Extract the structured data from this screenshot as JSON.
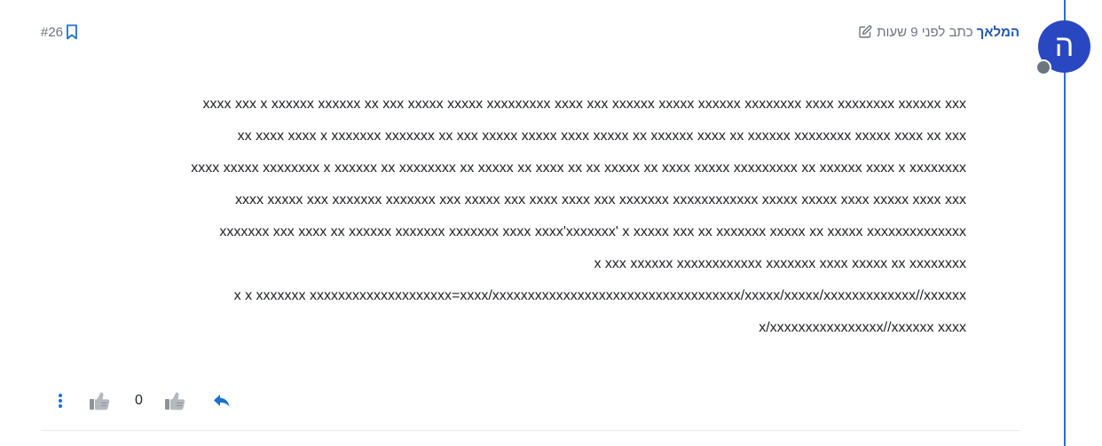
{
  "post": {
    "author_avatar_letter": "ה",
    "author_name": "המלאך",
    "meta_text": "כתב לפני 9 שעות",
    "index": "#26",
    "body_lines": [
      "xxxx xxx x xxxxxx xxxxxx xx xxx xxxxx xxxxx xxxxxxxxx xxxx xxx xxxxxx xxxxx xxxxxx xxxxxxxx xxxx xxxxxxxx xxxxxx xxx",
      "xx xxxx xxxx x xxxxxxx xxxxxxx xx xxx xxxxx xxxxx xxxx xxxxx xx xxxxxx xxxx xx xxxxxx xxxxxxxx xxxxx xxxx xx xxx",
      "xxxx xxxxx xxxxxxxx x xxxxxx xx xxxxxxxx xx xxxxx xx xxxx xx xx xxxxx xx xxxx xxxxx xxxxxxxxx xx xxxxxx xxxx x xxxxxxxx",
      "xxxx xxxxx xxx xxxxxxx xxxxxxx xxx xxxxx xxx xxxx xxxx xxx xxxxxxx xxxxxxxxxxxx xxxxx xxxxx xxxx xxxxx xxxx xxx",
      "xxxxxxx xxx xxxx xx xxxxxx xxxxxxx xxxxxxx xxxx xxxx'xxxxxxx' x xxxxx xxx xx xxxxxxx xxxxx xx xxxxx xxxxxxxxxxxxxx",
      "x xxx xxxxxx xxxxxxxxxxxx xxxxxxx xxxx xxxxx xx xxxxxxxx",
      "x x xxxxxxx xxxxxxxxxxxxxxxxxxxx=xxxx/xxxxxxxxxxxxxxxxxxxxxxxxxxxxxxxxxxx/xxxxx/xxxxx/xxxxxxxxxxxxx//xxxxxx",
      "x/xxxxxxxxxxxxxxxx//xxxxxx xxxx"
    ],
    "vote_count": "0"
  },
  "colors": {
    "accent": "#1f55b5",
    "avatar_bg": "#2a47c2",
    "timeline": "#2a6fcf",
    "muted": "#6c757d"
  },
  "icons": {
    "edited": "pencil-square-icon",
    "bookmark": "bookmark-icon",
    "more": "vertical-dots-icon",
    "downvote": "thumbs-down-icon",
    "upvote": "thumbs-up-icon",
    "reply": "reply-arrow-icon"
  }
}
